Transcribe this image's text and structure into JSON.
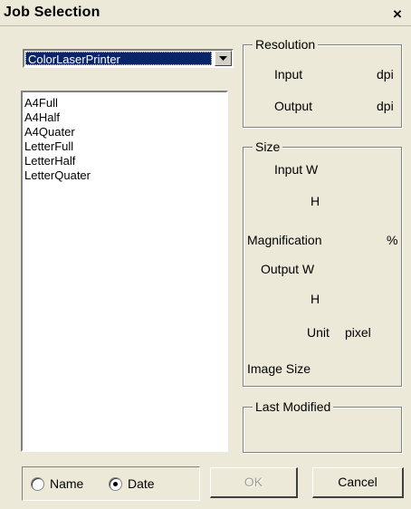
{
  "window": {
    "title": "Job Selection",
    "close_glyph": "×"
  },
  "printer_select": {
    "value": "ColorLaserPrinter",
    "arrow_icon": "chevron-down-icon"
  },
  "jobs": [
    "A4Full",
    "A4Half",
    "A4Quater",
    "LetterFull",
    "LetterHalf",
    "LetterQuater"
  ],
  "resolution": {
    "title": "Resolution",
    "input_label": "Input",
    "input_unit": "dpi",
    "output_label": "Output",
    "output_unit": "dpi"
  },
  "size": {
    "title": "Size",
    "input_w_label": "Input W",
    "input_h_label": "H",
    "magnification_label": "Magnification",
    "magnification_unit": "%",
    "output_w_label": "Output W",
    "output_h_label": "H",
    "unit_label": "Unit",
    "unit_value": "pixel",
    "image_size_label": "Image Size"
  },
  "last_modified": {
    "title": "Last Modified"
  },
  "sort": {
    "name_label": "Name",
    "date_label": "Date",
    "selected": "date"
  },
  "buttons": {
    "ok": "OK",
    "cancel": "Cancel"
  }
}
